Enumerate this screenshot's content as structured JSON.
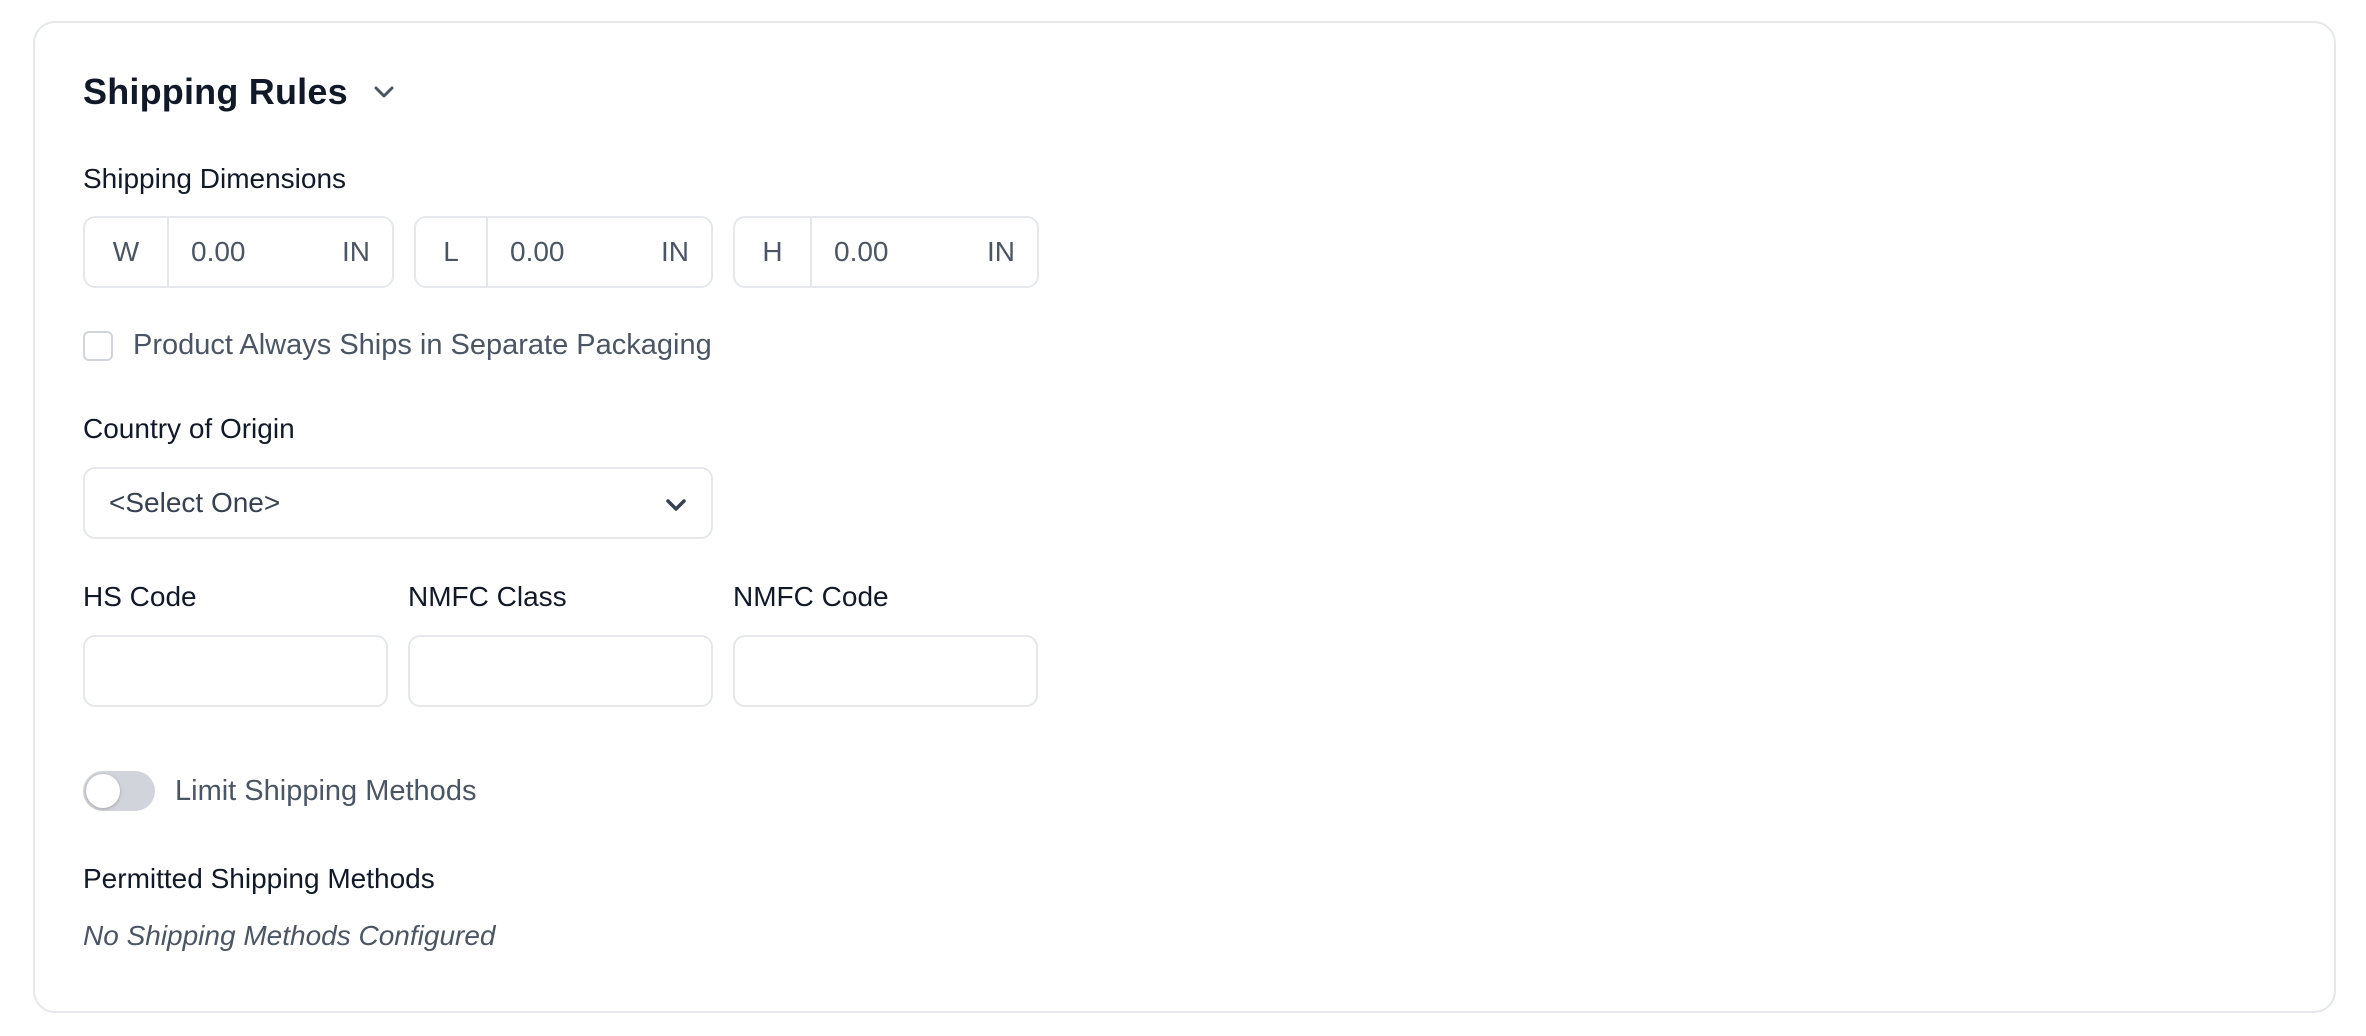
{
  "section": {
    "title": "Shipping Rules",
    "toggle_icon": "chevron-down-icon"
  },
  "dimensions": {
    "label": "Shipping Dimensions",
    "fields": [
      {
        "prefix": "W",
        "value": "0.00",
        "unit": "IN"
      },
      {
        "prefix": "L",
        "value": "0.00",
        "unit": "IN"
      },
      {
        "prefix": "H",
        "value": "0.00",
        "unit": "IN"
      }
    ]
  },
  "separate_packaging": {
    "label": "Product Always Ships in Separate Packaging",
    "checked": false
  },
  "country_of_origin": {
    "label": "Country of Origin",
    "selected": "<Select One>",
    "icon": "chevron-down-icon"
  },
  "codes": {
    "hs_code": {
      "label": "HS Code",
      "value": ""
    },
    "nmfc_class": {
      "label": "NMFC Class",
      "value": ""
    },
    "nmfc_code": {
      "label": "NMFC Code",
      "value": ""
    }
  },
  "limit_shipping": {
    "label": "Limit Shipping Methods",
    "enabled": false
  },
  "permitted_methods": {
    "label": "Permitted Shipping Methods",
    "empty_text": "No Shipping Methods Configured"
  },
  "colors": {
    "border": "#e5e7eb",
    "text_primary": "#111827",
    "text_secondary": "#4b5563",
    "toggle_off": "#d1d5db"
  }
}
